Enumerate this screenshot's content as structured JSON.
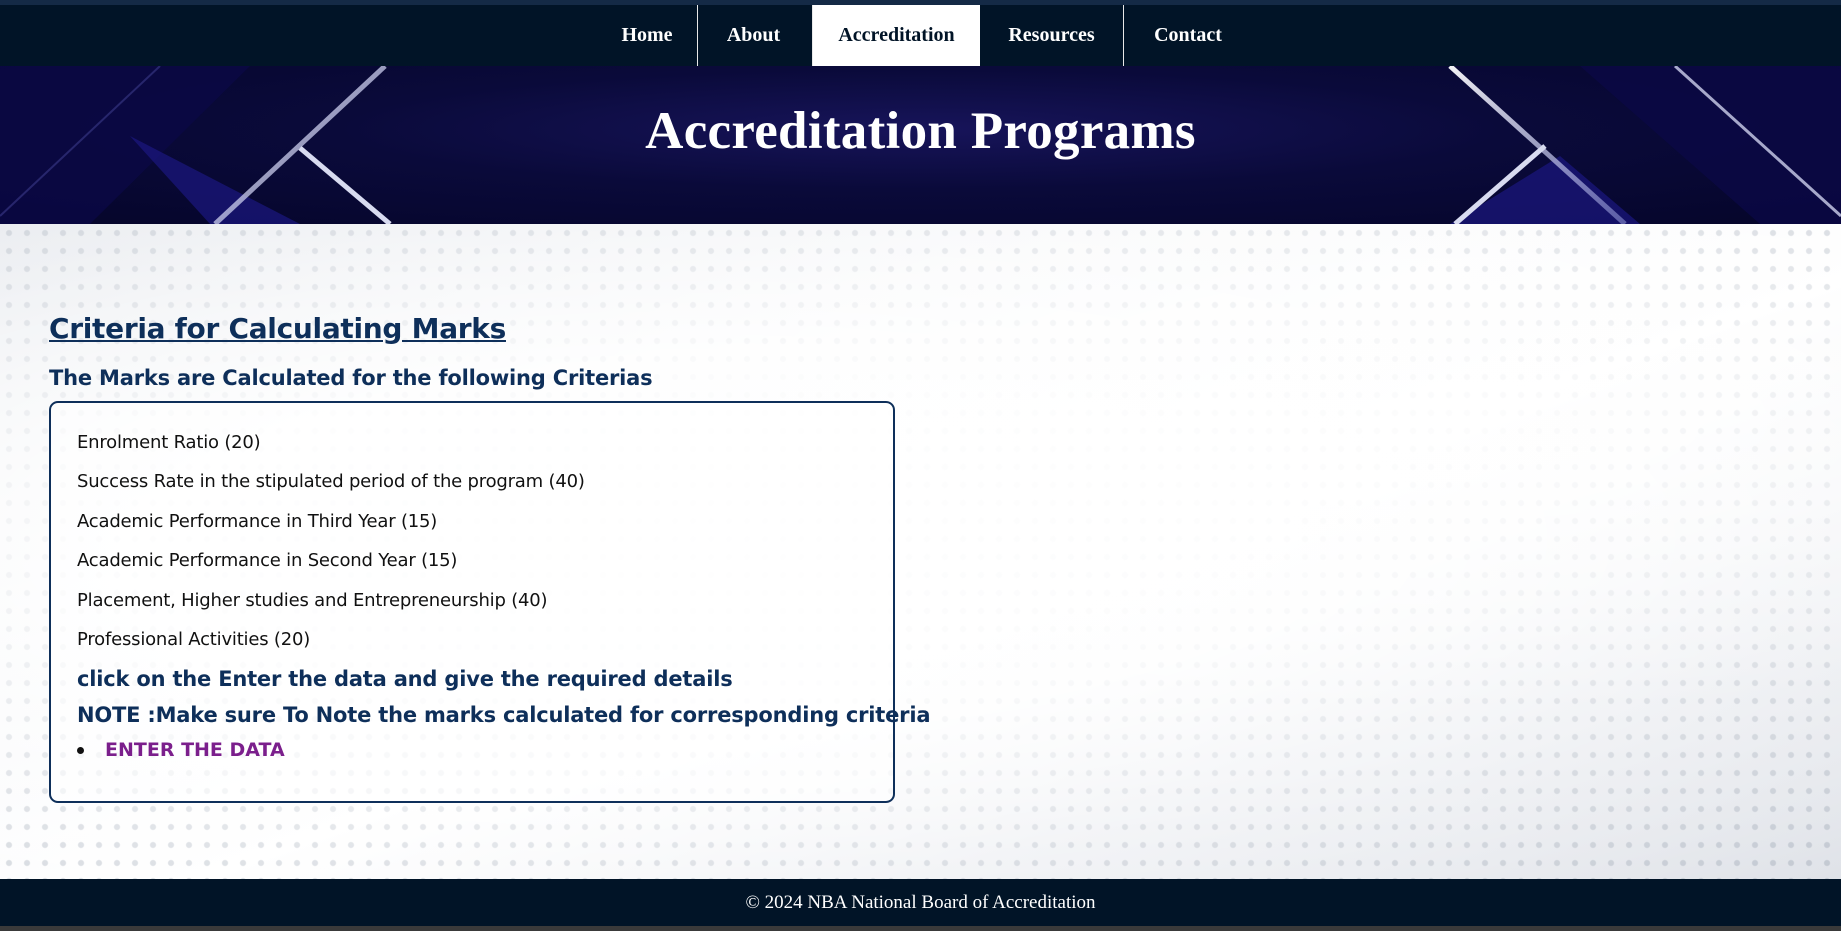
{
  "nav": {
    "items": [
      {
        "label": "Home",
        "active": false
      },
      {
        "label": "About",
        "active": false
      },
      {
        "label": "Accreditation",
        "active": true
      },
      {
        "label": "Resources",
        "active": false
      },
      {
        "label": "Contact",
        "active": false
      }
    ]
  },
  "hero": {
    "title": "Accreditation Programs"
  },
  "main": {
    "heading": "Criteria for Calculating Marks",
    "subheading": "The Marks are Calculated for the following Criterias",
    "criteria": [
      "Enrolment Ratio (20)",
      "Success Rate in the stipulated period of the program (40)",
      "Academic Performance in Third Year (15)",
      "Academic Performance in Second Year (15)",
      "Placement, Higher studies and Entrepreneurship (40)",
      "Professional Activities (20)"
    ],
    "instruction": "click on the Enter the data and give the required details",
    "note": "NOTE :Make sure To Note the marks calculated for corresponding criteria",
    "enter_link": "ENTER THE DATA"
  },
  "footer": {
    "text": "© 2024 NBA National Board of Accreditation"
  },
  "colors": {
    "nav_bg": "#011427",
    "heading": "#0e2f5a",
    "link": "#7b1f8c"
  }
}
